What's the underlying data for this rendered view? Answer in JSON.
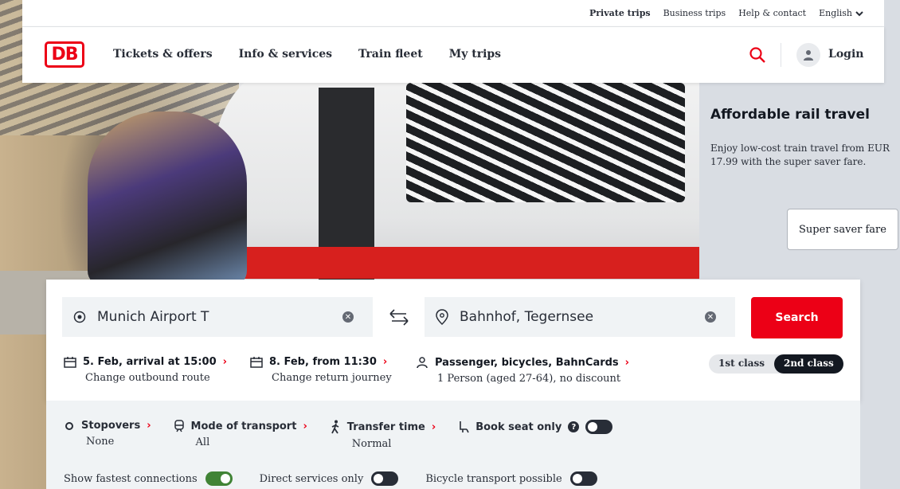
{
  "utility": {
    "private_trips": "Private trips",
    "business_trips": "Business trips",
    "help_contact": "Help & contact",
    "language": "English"
  },
  "header": {
    "logo": "DB",
    "nav": [
      "Tickets & offers",
      "Info & services",
      "Train fleet",
      "My trips"
    ],
    "login": "Login"
  },
  "promo": {
    "title": "Affordable rail travel",
    "text": "Enjoy low-cost train travel from EUR 17.99 with the super saver fare.",
    "button": "Super saver fare"
  },
  "search": {
    "from": "Munich Airport T",
    "to": "Bahnhof, Tegernsee",
    "button": "Search",
    "outbound": {
      "label": "5. Feb, arrival at 15:00",
      "sub": "Change outbound route"
    },
    "return": {
      "label": "8. Feb, from 11:30",
      "sub": "Change return journey"
    },
    "passengers": {
      "label": "Passenger, bicycles, BahnCards",
      "sub": "1 Person (aged 27-64), no discount"
    },
    "class_1": "1st class",
    "class_2": "2nd class",
    "selected_class": "2nd class"
  },
  "options": {
    "stopovers": {
      "label": "Stopovers",
      "value": "None"
    },
    "mode": {
      "label": "Mode of transport",
      "value": "All"
    },
    "transfer": {
      "label": "Transfer time",
      "value": "Normal"
    },
    "seat_only": {
      "label": "Book seat only",
      "on": false
    },
    "fastest": {
      "label": "Show fastest connections",
      "on": true
    },
    "direct": {
      "label": "Direct services only",
      "on": false
    },
    "bicycle": {
      "label": "Bicycle transport possible",
      "on": false
    }
  },
  "colors": {
    "brand_red": "#ec0016",
    "toggle_on": "#408335",
    "dark": "#131821"
  }
}
